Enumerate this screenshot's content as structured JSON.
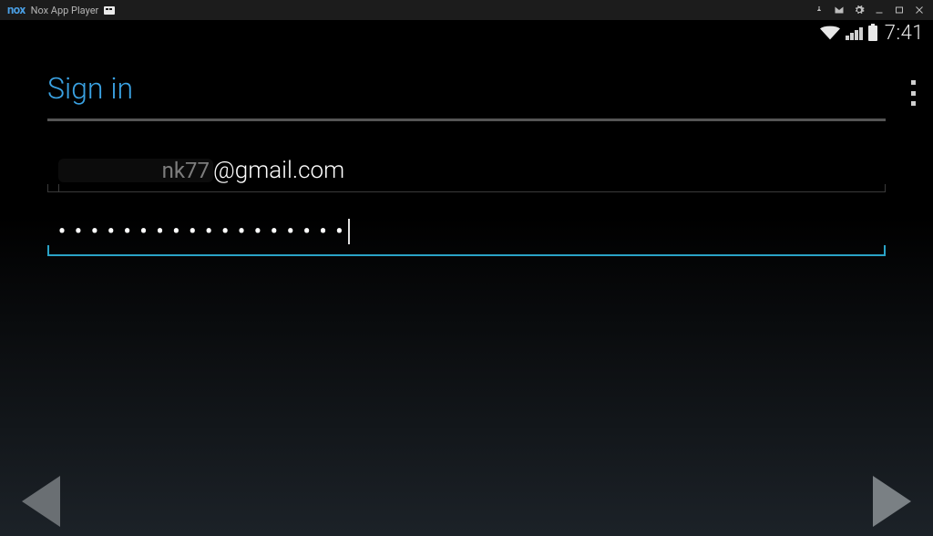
{
  "titlebar": {
    "logo": "nox",
    "title": "Nox App Player"
  },
  "statusbar": {
    "clock": "7:41"
  },
  "page": {
    "heading": "Sign in"
  },
  "email": {
    "masked_prefix": "nk77",
    "visible_suffix": "@gmail.com"
  },
  "password": {
    "mask": "••••••••••••••••••"
  }
}
